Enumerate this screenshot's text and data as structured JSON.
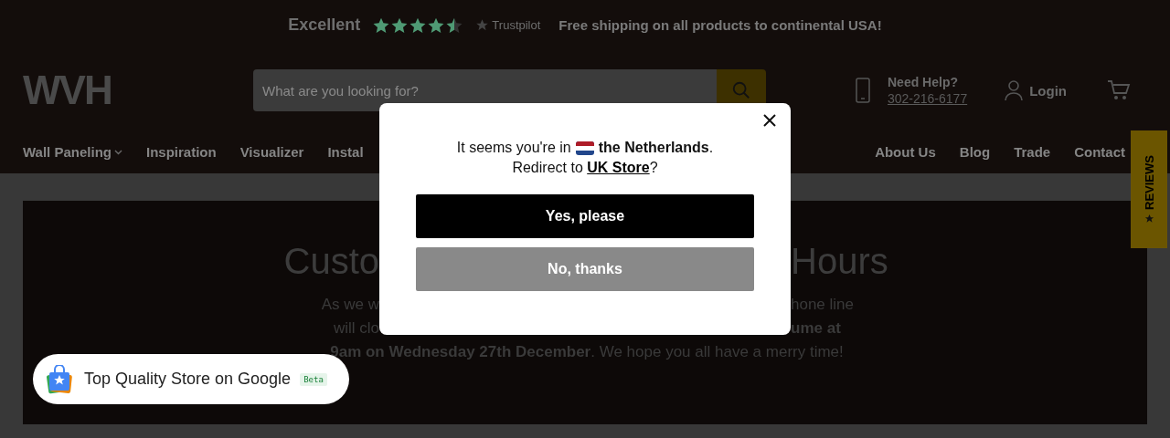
{
  "top_bar": {
    "rating_label": "Excellent",
    "stars": 4.5,
    "brand": "Trustpilot",
    "promo": "Free shipping on all products to continental USA!"
  },
  "header": {
    "logo": "WVH",
    "search": {
      "placeholder": "What are you looking for?"
    },
    "help_title": "Need Help?",
    "phone": "302-216-6177",
    "login": "Login"
  },
  "nav": {
    "left": [
      {
        "label": "Wall Paneling",
        "dropdown": true
      },
      {
        "label": "Inspiration",
        "dropdown": false
      },
      {
        "label": "Visualizer",
        "dropdown": false
      },
      {
        "label": "Instal",
        "dropdown": false
      }
    ],
    "right": [
      {
        "label": "About Us"
      },
      {
        "label": "Blog"
      },
      {
        "label": "Trade"
      },
      {
        "label": "Contact"
      }
    ]
  },
  "reviews_tab": {
    "label": "REVIEWS"
  },
  "hero": {
    "title": [
      "Custo",
      "Hours"
    ],
    "line_1": [
      "As we w",
      "hone line"
    ],
    "line_2": [
      "will clo",
      "ume at"
    ],
    "line_3": "**9am on Wednesday 27th December**. We hope you all have a merry time!"
  },
  "google_badge": {
    "label": "Top Quality Store on Google",
    "tag": "Beta"
  },
  "modal": {
    "line_1_prefix": "It seems you're in",
    "country": "**the Netherlands**.",
    "line_2": {
      "prefix": "Redirect to ",
      "link": "UK Store",
      "suffix": "?"
    },
    "buttons": [
      {
        "label": "Yes, please",
        "kind": "primary"
      },
      {
        "label": "No, thanks",
        "kind": "secondary"
      }
    ]
  }
}
